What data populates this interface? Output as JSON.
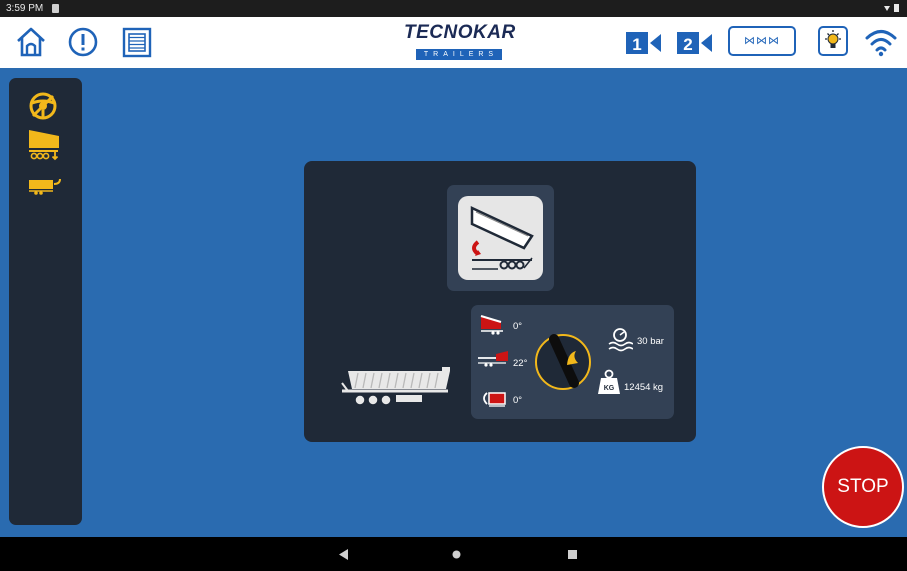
{
  "status_bar": {
    "time": "3:59 PM",
    "system_icons": "wifi-icon battery-icon"
  },
  "header": {
    "brand_name": "TECNOKAR",
    "brand_sub": "TRAILERS",
    "camera1_label": "1",
    "camera2_label": "2",
    "split_view_label": "⋈⋈⋈"
  },
  "info_panel": {
    "tilt_front_angle": "0°",
    "tilt_side_angle": "22°",
    "tailgate_angle": "0°",
    "pressure": "30 bar",
    "weight": "12454 kg",
    "weight_badge": "KG"
  },
  "stop_button": {
    "label": "STOP"
  },
  "colors": {
    "accent": "#1f63b8",
    "warning": "#f2b81b",
    "stop": "#cc1414",
    "panel": "#1f2937"
  },
  "icons": [
    "home-icon",
    "alert-icon",
    "list-icon",
    "camera-1-icon",
    "camera-2-icon",
    "split-view-icon",
    "light-icon",
    "wifi-icon",
    "no-steering-icon",
    "tipper-raise-icon",
    "trailer-hook-icon",
    "tipper-tile-icon",
    "pressure-icon",
    "weight-icon"
  ]
}
